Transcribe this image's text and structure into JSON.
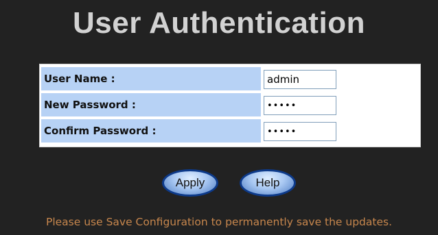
{
  "page": {
    "title": "User Authentication"
  },
  "form": {
    "rows": [
      {
        "label": "User Name :",
        "value": "admin",
        "type": "text"
      },
      {
        "label": "New Password :",
        "value": "•••••",
        "type": "password"
      },
      {
        "label": "Confirm Password :",
        "value": "•••••",
        "type": "password"
      }
    ]
  },
  "buttons": {
    "apply_label": "Apply",
    "help_label": "Help"
  },
  "notice": {
    "text": "Please use Save Configuration to permanently save the updates."
  },
  "colors": {
    "background": "#222222",
    "title": "#d2d2d2",
    "label_cell": "#b7d2f5",
    "button_border": "#0d3a8a",
    "notice_text": "#c8874d"
  }
}
